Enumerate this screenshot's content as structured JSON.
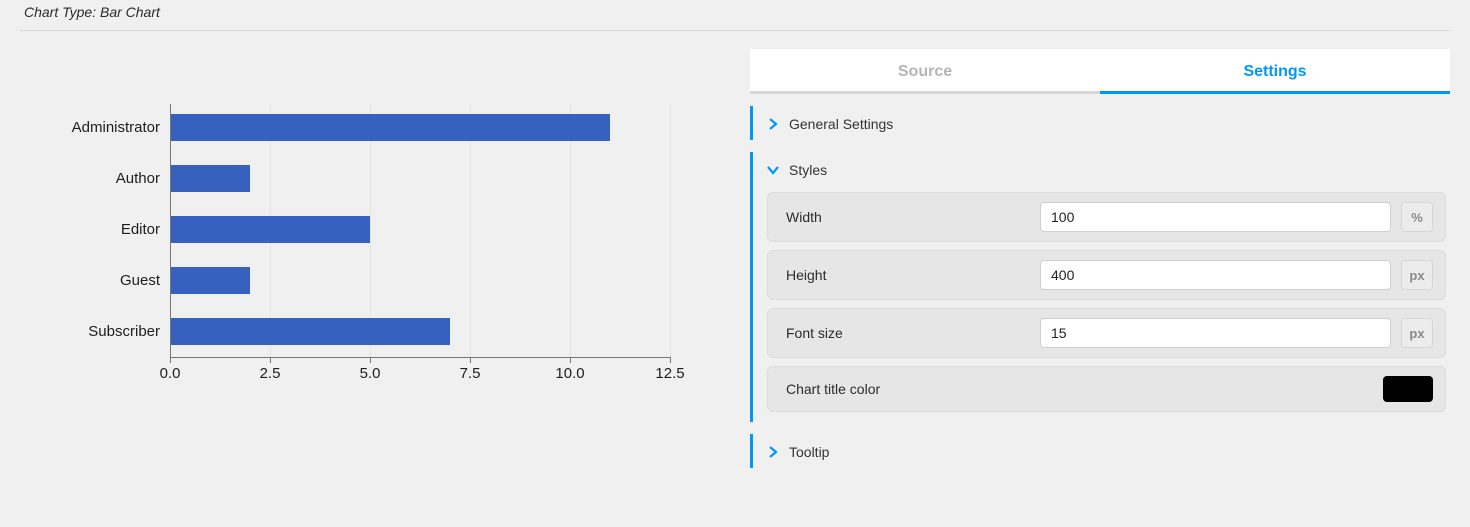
{
  "header": {
    "label": "Chart Type: Bar Chart"
  },
  "tabs": {
    "source": "Source",
    "settings": "Settings"
  },
  "sections": {
    "general": {
      "title": "General Settings"
    },
    "styles": {
      "title": "Styles",
      "fields": {
        "width": {
          "label": "Width",
          "value": "100",
          "unit": "%"
        },
        "height": {
          "label": "Height",
          "value": "400",
          "unit": "px"
        },
        "font_size": {
          "label": "Font size",
          "value": "15",
          "unit": "px"
        },
        "title_color": {
          "label": "Chart title color",
          "value": "#000000"
        }
      }
    },
    "tooltip": {
      "title": "Tooltip"
    }
  },
  "chart_data": {
    "type": "bar",
    "orientation": "horizontal",
    "categories": [
      "Administrator",
      "Author",
      "Editor",
      "Guest",
      "Subscriber"
    ],
    "values": [
      11,
      2,
      5,
      2,
      7
    ],
    "x_ticks": [
      "0.0",
      "2.5",
      "5.0",
      "7.5",
      "10.0",
      "12.5"
    ],
    "xlim": [
      0,
      12.5
    ],
    "title": "",
    "xlabel": "",
    "ylabel": "",
    "bar_color": "#3661be",
    "legend": false
  }
}
